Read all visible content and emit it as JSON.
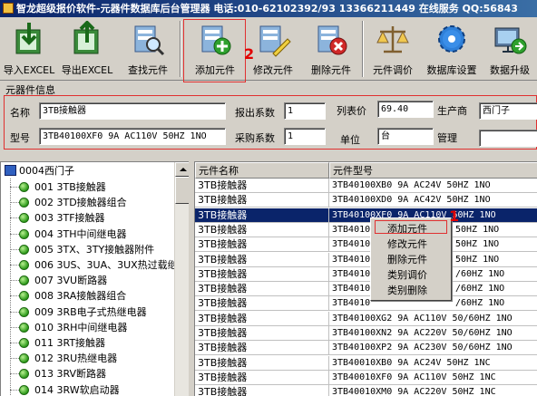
{
  "window": {
    "title": "智龙超级报价软件-元器件数据库后台管理器 电话:010-62102392/93 13366211449 在线服务 QQ:56843"
  },
  "toolbar": {
    "import_excel": "导入EXCEL",
    "export_excel": "导出EXCEL",
    "find_component": "查找元件",
    "add_component": "添加元件",
    "edit_component": "修改元件",
    "delete_component": "删除元件",
    "adjust_price": "元件调价",
    "db_settings": "数据库设置",
    "upgrade": "数据升级",
    "callout_number": "2"
  },
  "info": {
    "group_title": "元器件信息",
    "name_label": "名称",
    "name_value": "3TB接触器",
    "quote_coef_label": "报出系数",
    "quote_coef_value": "1",
    "list_price_label": "列表价",
    "list_price_value": "69.40",
    "manufacturer_label": "生产商",
    "manufacturer_value": "西门子",
    "model_label": "型号",
    "model_value": "3TB40100XF0 9A AC110V 50HZ 1NO",
    "purchase_coef_label": "采购系数",
    "purchase_coef_value": "1",
    "unit_label": "单位",
    "unit_value": "台",
    "manage_label": "管理",
    "manage_value": ""
  },
  "tree": {
    "root": "0004西门子",
    "items": [
      "001 3TB接触器",
      "002 3TD接触器组合",
      "003 3TF接触器",
      "004 3TH中间继电器",
      "005 3TX、3TY接触器附件",
      "006 3US、3UA、3UX热过载继",
      "007 3VU断路器",
      "008 3RA接触器组合",
      "009 3RB电子式热继电器",
      "010 3RH中间继电器",
      "011 3RT接触器",
      "012 3RU热继电器",
      "013 3RV断路器",
      "014 3RW软启动器",
      "015 3RP时间继电器"
    ]
  },
  "grid": {
    "headers": [
      "元件名称",
      "元件型号"
    ],
    "rows": [
      [
        "3TB接触器",
        "3TB40100XB0 9A AC24V 50HZ 1NO"
      ],
      [
        "3TB接触器",
        "3TB40100XD0 9A AC42V 50HZ 1NO"
      ],
      [
        "3TB接触器",
        "3TB40100XF0 9A AC110V 50HZ 1NO"
      ],
      [
        "3TB接触器",
        "3TB40100XM0 9A AC220V 50HZ 1NO"
      ],
      [
        "3TB接触器",
        "3TB40100XN0 9A AC220V 50HZ 1NO"
      ],
      [
        "3TB接触器",
        "3TB40100XP0 9A AC230V 50HZ 1NO"
      ],
      [
        "3TB接触器",
        "3TB40100XB2 9A AC24V 50/60HZ 1NO"
      ],
      [
        "3TB接触器",
        "3TB40100XD2 9A AC42V 50/60HZ 1NO"
      ],
      [
        "3TB接触器",
        "3TB40100XF2 9A AC110V 50/60HZ 1NO"
      ],
      [
        "3TB接触器",
        "3TB40100XG2 9A AC110V 50/60HZ 1NO"
      ],
      [
        "3TB接触器",
        "3TB40100XN2 9A AC220V 50/60HZ 1NO"
      ],
      [
        "3TB接触器",
        "3TB40100XP2 9A AC230V 50/60HZ 1NO"
      ],
      [
        "3TB接触器",
        "3TB40010XB0 9A AC24V 50HZ 1NC"
      ],
      [
        "3TB接触器",
        "3TB40010XF0 9A AC110V 50HZ 1NC"
      ],
      [
        "3TB接触器",
        "3TB40010XM0 9A AC220V 50HZ 1NC"
      ]
    ],
    "visible_cells": [
      [
        "3TB接触器",
        "3TB40100XB0 9A AC24V 50HZ 1NO"
      ],
      [
        "3TB接触器",
        "3TB40100XD0 9A AC42V 50HZ 1NO"
      ],
      [
        "3TB接触器",
        "3TB40100XF0 9A AC110V 50HZ 1NO"
      ],
      [
        "3TB接触器",
        "3TB4010"
      ],
      [
        "3TB接触器",
        "3TB4010"
      ],
      [
        "3TB接触器",
        "3TB4010"
      ],
      [
        "3TB接触器",
        "3TB4010"
      ],
      [
        "3TB接触器",
        "3TB4010"
      ],
      [
        "3TB接触器",
        "3TB4010"
      ],
      [
        "3TB接触器",
        "3TB40100XG2 9A AC110V 50/60HZ 1NO"
      ],
      [
        "3TB接触器",
        "3TB40100XN2 9A AC220V 50/60HZ 1NO"
      ],
      [
        "3TB接触器",
        "3TB40100XP2 9A AC230V 50/60HZ 1NO"
      ],
      [
        "3TB接触器",
        "3TB40010XB0 9A AC24V 50HZ 1NC"
      ],
      [
        "3TB接触器",
        "3TB40010XF0 9A AC110V 50HZ 1NC"
      ],
      [
        "3TB接触器",
        "3TB40010XM0 9A AC220V 50HZ 1NC"
      ]
    ],
    "right_of_menu": [
      "",
      "",
      "",
      "50HZ 1NO",
      "50HZ 1NO",
      "50HZ 1NO",
      "/60HZ 1NO",
      "/60HZ 1NO",
      "/60HZ 1NO",
      "",
      "",
      "",
      "",
      "",
      ""
    ],
    "selected_index": 2
  },
  "context_menu": {
    "items": [
      "添加元件",
      "修改元件",
      "删除元件",
      "类别调价",
      "类别删除"
    ],
    "callout_number": "1"
  }
}
